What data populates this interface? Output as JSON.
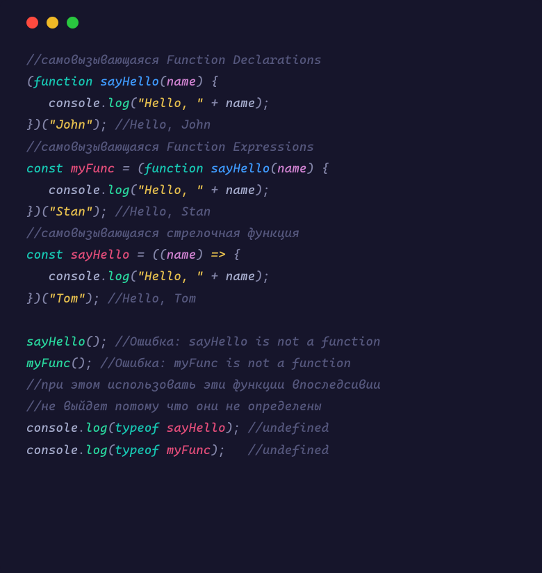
{
  "code": {
    "lines": [
      [
        {
          "cls": "tok-comment",
          "txt": "//самовызывающаяся Function Declarations"
        }
      ],
      [
        {
          "cls": "tok-punct",
          "txt": "("
        },
        {
          "cls": "tok-keyword",
          "txt": "function"
        },
        {
          "cls": "tok-punct",
          "txt": " "
        },
        {
          "cls": "tok-func-decl",
          "txt": "sayHello"
        },
        {
          "cls": "tok-punct",
          "txt": "("
        },
        {
          "cls": "tok-param",
          "txt": "name"
        },
        {
          "cls": "tok-punct",
          "txt": ") {"
        }
      ],
      [
        {
          "cls": "tok-punct",
          "txt": "   "
        },
        {
          "cls": "tok-prop",
          "txt": "console"
        },
        {
          "cls": "tok-punct",
          "txt": "."
        },
        {
          "cls": "tok-func-call",
          "txt": "log"
        },
        {
          "cls": "tok-punct",
          "txt": "("
        },
        {
          "cls": "tok-string",
          "txt": "\"Hello, \""
        },
        {
          "cls": "tok-punct",
          "txt": " + "
        },
        {
          "cls": "tok-prop",
          "txt": "name"
        },
        {
          "cls": "tok-punct",
          "txt": ");"
        }
      ],
      [
        {
          "cls": "tok-punct",
          "txt": "})("
        },
        {
          "cls": "tok-string",
          "txt": "\"John\""
        },
        {
          "cls": "tok-punct",
          "txt": "); "
        },
        {
          "cls": "tok-comment",
          "txt": "//Hello, John"
        }
      ],
      [
        {
          "cls": "tok-comment",
          "txt": "//самовызывающаяся Function Expressions"
        }
      ],
      [
        {
          "cls": "tok-keyword",
          "txt": "const"
        },
        {
          "cls": "tok-punct",
          "txt": " "
        },
        {
          "cls": "tok-var",
          "txt": "myFunc"
        },
        {
          "cls": "tok-punct",
          "txt": " = ("
        },
        {
          "cls": "tok-keyword",
          "txt": "function"
        },
        {
          "cls": "tok-punct",
          "txt": " "
        },
        {
          "cls": "tok-func-decl",
          "txt": "sayHello"
        },
        {
          "cls": "tok-punct",
          "txt": "("
        },
        {
          "cls": "tok-param",
          "txt": "name"
        },
        {
          "cls": "tok-punct",
          "txt": ") {"
        }
      ],
      [
        {
          "cls": "tok-punct",
          "txt": "   "
        },
        {
          "cls": "tok-prop",
          "txt": "console"
        },
        {
          "cls": "tok-punct",
          "txt": "."
        },
        {
          "cls": "tok-func-call",
          "txt": "log"
        },
        {
          "cls": "tok-punct",
          "txt": "("
        },
        {
          "cls": "tok-string",
          "txt": "\"Hello, \""
        },
        {
          "cls": "tok-punct",
          "txt": " + "
        },
        {
          "cls": "tok-prop",
          "txt": "name"
        },
        {
          "cls": "tok-punct",
          "txt": ");"
        }
      ],
      [
        {
          "cls": "tok-punct",
          "txt": "})("
        },
        {
          "cls": "tok-string",
          "txt": "\"Stan\""
        },
        {
          "cls": "tok-punct",
          "txt": "); "
        },
        {
          "cls": "tok-comment",
          "txt": "//Hello, Stan"
        }
      ],
      [
        {
          "cls": "tok-comment",
          "txt": "//самовызывающаяся стрелочная функция"
        }
      ],
      [
        {
          "cls": "tok-keyword",
          "txt": "const"
        },
        {
          "cls": "tok-punct",
          "txt": " "
        },
        {
          "cls": "tok-var",
          "txt": "sayHello"
        },
        {
          "cls": "tok-punct",
          "txt": " = (("
        },
        {
          "cls": "tok-param",
          "txt": "name"
        },
        {
          "cls": "tok-punct",
          "txt": ") "
        },
        {
          "cls": "tok-arrow",
          "txt": "=>"
        },
        {
          "cls": "tok-punct",
          "txt": " {"
        }
      ],
      [
        {
          "cls": "tok-punct",
          "txt": "   "
        },
        {
          "cls": "tok-prop",
          "txt": "console"
        },
        {
          "cls": "tok-punct",
          "txt": "."
        },
        {
          "cls": "tok-func-call",
          "txt": "log"
        },
        {
          "cls": "tok-punct",
          "txt": "("
        },
        {
          "cls": "tok-string",
          "txt": "\"Hello, \""
        },
        {
          "cls": "tok-punct",
          "txt": " + "
        },
        {
          "cls": "tok-prop",
          "txt": "name"
        },
        {
          "cls": "tok-punct",
          "txt": ");"
        }
      ],
      [
        {
          "cls": "tok-punct",
          "txt": "})("
        },
        {
          "cls": "tok-string",
          "txt": "\"Tom\""
        },
        {
          "cls": "tok-punct",
          "txt": "); "
        },
        {
          "cls": "tok-comment",
          "txt": "//Hello, Tom"
        }
      ],
      [],
      [
        {
          "cls": "tok-func-call",
          "txt": "sayHello"
        },
        {
          "cls": "tok-punct",
          "txt": "(); "
        },
        {
          "cls": "tok-comment",
          "txt": "//Ошибка: sayHello is not a function"
        }
      ],
      [
        {
          "cls": "tok-func-call",
          "txt": "myFunc"
        },
        {
          "cls": "tok-punct",
          "txt": "(); "
        },
        {
          "cls": "tok-comment",
          "txt": "//Ошибка: myFunc is not a function"
        }
      ],
      [
        {
          "cls": "tok-comment",
          "txt": "//при этом использовать эти функции впоследсивии"
        }
      ],
      [
        {
          "cls": "tok-comment",
          "txt": "//не выйдет потому что они не определены"
        }
      ],
      [
        {
          "cls": "tok-prop",
          "txt": "console"
        },
        {
          "cls": "tok-punct",
          "txt": "."
        },
        {
          "cls": "tok-func-call",
          "txt": "log"
        },
        {
          "cls": "tok-punct",
          "txt": "("
        },
        {
          "cls": "tok-typeof",
          "txt": "typeof"
        },
        {
          "cls": "tok-punct",
          "txt": " "
        },
        {
          "cls": "tok-var",
          "txt": "sayHello"
        },
        {
          "cls": "tok-punct",
          "txt": "); "
        },
        {
          "cls": "tok-comment",
          "txt": "//undefined"
        }
      ],
      [
        {
          "cls": "tok-prop",
          "txt": "console"
        },
        {
          "cls": "tok-punct",
          "txt": "."
        },
        {
          "cls": "tok-func-call",
          "txt": "log"
        },
        {
          "cls": "tok-punct",
          "txt": "("
        },
        {
          "cls": "tok-typeof",
          "txt": "typeof"
        },
        {
          "cls": "tok-punct",
          "txt": " "
        },
        {
          "cls": "tok-var",
          "txt": "myFunc"
        },
        {
          "cls": "tok-punct",
          "txt": ");   "
        },
        {
          "cls": "tok-comment",
          "txt": "//undefined"
        }
      ]
    ]
  }
}
